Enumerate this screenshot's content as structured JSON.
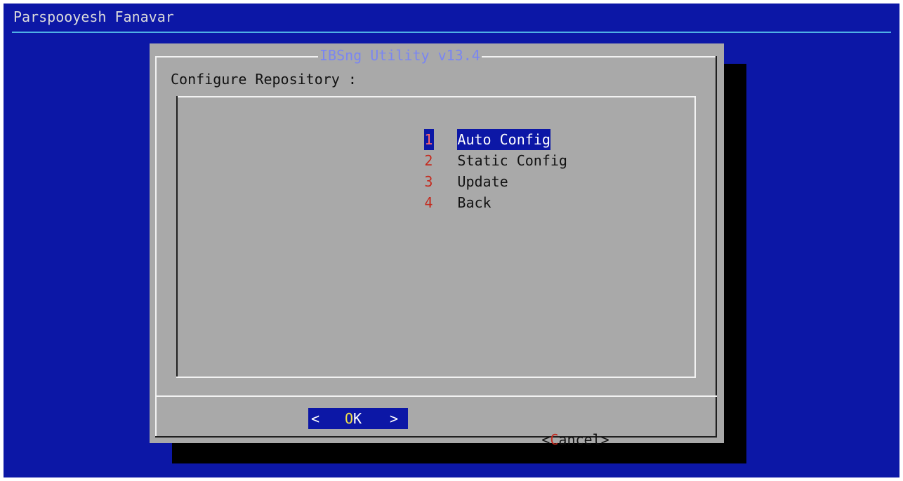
{
  "backtitle": "Parspooyesh Fanavar",
  "dialog": {
    "title": "IBSng Utility v13.4",
    "prompt": "Configure Repository :"
  },
  "menu": {
    "items": [
      {
        "key": "1",
        "label": "Auto Config",
        "selected": true
      },
      {
        "key": "2",
        "label": "Static Config",
        "selected": false
      },
      {
        "key": "3",
        "label": "Update",
        "selected": false
      },
      {
        "key": "4",
        "label": "Back",
        "selected": false
      }
    ]
  },
  "buttons": {
    "ok": {
      "left_bracket": "<",
      "hotkey": "O",
      "rest": "K",
      "right_bracket": ">"
    },
    "cancel": {
      "left_bracket": "<",
      "hotkey": "C",
      "rest": "ancel",
      "right_bracket": ">"
    }
  },
  "colors": {
    "screen_background": "#0c17a6",
    "dialog_background": "#a9a9a9",
    "title_text": "#7a86f2",
    "hotkey_red": "#c42a1e",
    "selection_background": "#0c17a6",
    "ok_hotkey_yellow": "#f2e34a"
  }
}
